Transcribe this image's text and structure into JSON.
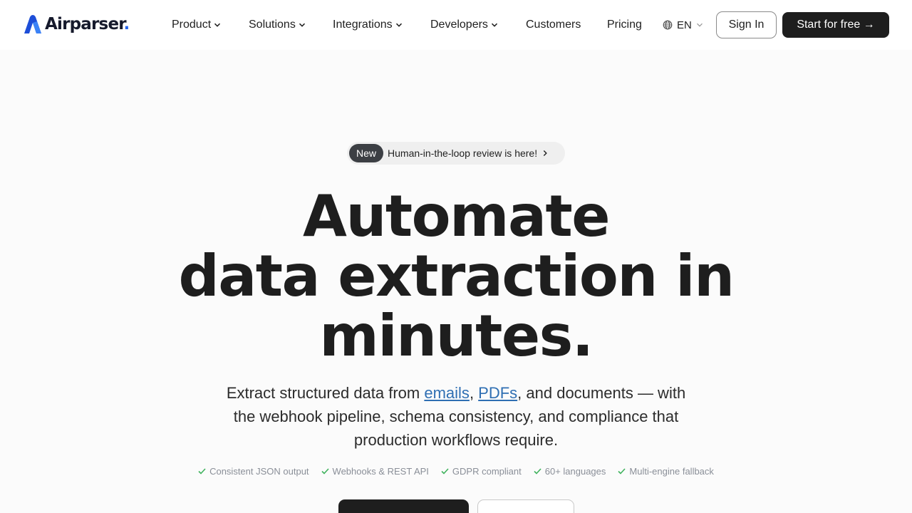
{
  "header": {
    "logo_text": "Airparser",
    "logo_dot": ".",
    "nav": [
      {
        "label": "Product",
        "has_dropdown": true
      },
      {
        "label": "Solutions",
        "has_dropdown": true
      },
      {
        "label": "Integrations",
        "has_dropdown": true
      },
      {
        "label": "Developers",
        "has_dropdown": true
      },
      {
        "label": "Customers",
        "has_dropdown": false
      },
      {
        "label": "Pricing",
        "has_dropdown": false
      }
    ],
    "language": "EN",
    "signin_label": "Sign In",
    "start_label": "Start for free →"
  },
  "hero": {
    "badge": "New",
    "announcement": "Human-in-the-loop review is here!",
    "headline": [
      "Automate",
      "data extraction in",
      "minutes."
    ],
    "sub_before": "Extract structured data from ",
    "link_emails": "emails",
    "sub_comma": ", ",
    "link_pdfs": "PDFs",
    "sub_after": ", and documents — with the webhook pipeline, schema consistency, and compliance that production workflows require.",
    "features": [
      "Consistent JSON output",
      "Webhooks & REST API",
      "GDPR compliant",
      "60+ languages",
      "Multi-engine fallback"
    ]
  },
  "colors": {
    "accent": "#2563eb",
    "link": "#2f6fb3",
    "check": "#3fb25d",
    "dark_button": "#1e1e1e"
  }
}
